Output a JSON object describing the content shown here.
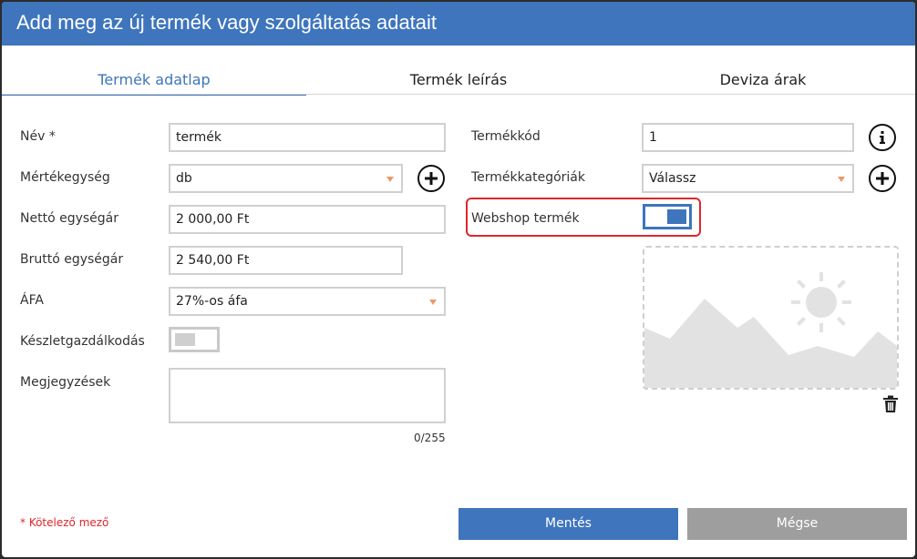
{
  "dialog": {
    "title": "Add meg az új termék vagy szolgáltatás adatait"
  },
  "tabs": [
    {
      "label": "Termék adatlap",
      "active": true
    },
    {
      "label": "Termék leírás",
      "active": false
    },
    {
      "label": "Deviza árak",
      "active": false
    }
  ],
  "form_left": {
    "name": {
      "label": "Név *",
      "value": "termék"
    },
    "unit": {
      "label": "Mértékegység",
      "value": "db"
    },
    "net_price": {
      "label": "Nettó egységár",
      "value": "2 000,00 Ft"
    },
    "gross_price": {
      "label": "Bruttó egységár",
      "value": "2 540,00 Ft"
    },
    "vat": {
      "label": "ÁFA",
      "value": "27%-os áfa"
    },
    "stock": {
      "label": "Készletgazdálkodás",
      "enabled": false
    },
    "notes": {
      "label": "Megjegyzések",
      "value": "",
      "counter": "0/255"
    }
  },
  "form_right": {
    "code": {
      "label": "Termékkód",
      "value": "1"
    },
    "categories": {
      "label": "Termékkategóriák",
      "value": "Válassz"
    },
    "webshop": {
      "label": "Webshop termék",
      "enabled": true
    }
  },
  "footer": {
    "required_note": "* Kötelező mező",
    "save_label": "Mentés",
    "cancel_label": "Mégse"
  },
  "colors": {
    "accent": "#3e75bd",
    "highlight": "#e0262b",
    "caret": "#e89b6a",
    "cancel": "#9e9e9e"
  },
  "icons": [
    "plus-icon",
    "info-icon",
    "image-placeholder-icon",
    "trash-icon",
    "chevron-down-icon"
  ]
}
